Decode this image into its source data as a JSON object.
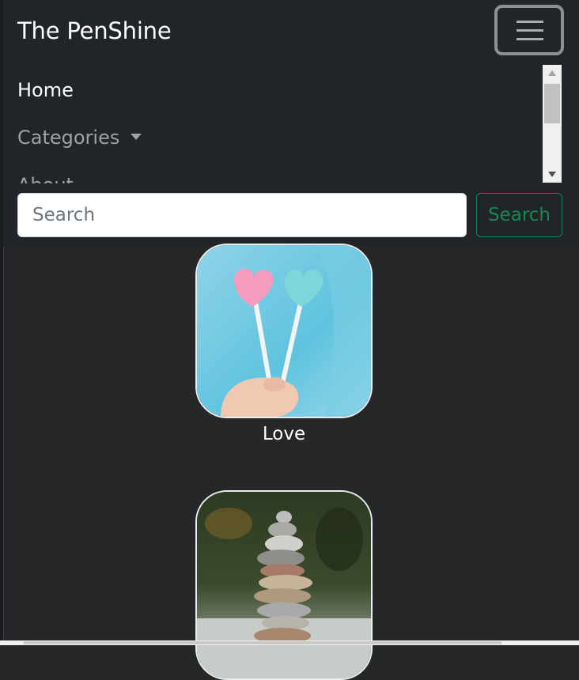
{
  "navbar": {
    "brand": "The PenShine",
    "items": [
      {
        "label": "Home"
      },
      {
        "label": "Categories"
      },
      {
        "label": "About"
      }
    ],
    "search": {
      "placeholder": "Search",
      "button_label": "Search"
    }
  },
  "categories": [
    {
      "title": "Love",
      "image": "heart-lollipops-image"
    },
    {
      "title": "",
      "image": "stacked-stones-image"
    }
  ],
  "colors": {
    "navbar_bg": "#212529",
    "page_bg": "#252729",
    "search_accent": "#198754"
  }
}
